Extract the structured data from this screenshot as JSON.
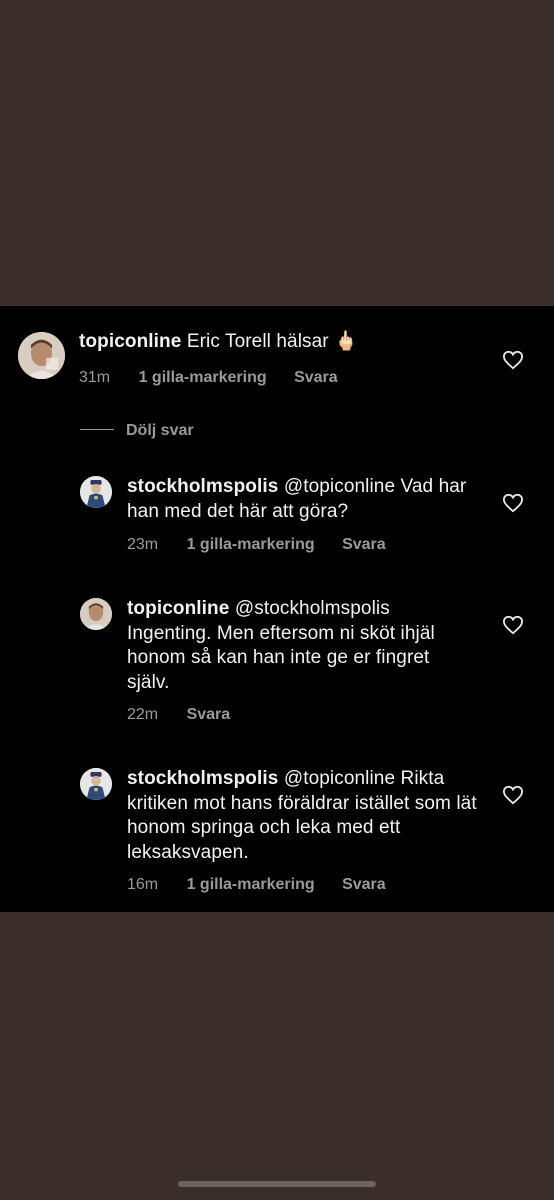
{
  "comments": [
    {
      "username": "topiconline",
      "text": "Eric Torell hälsar 🖕🏻",
      "time": "31m",
      "likes": "1 gilla-markering",
      "reply": "Svara"
    }
  ],
  "hide_replies": "Dölj svar",
  "replies": [
    {
      "username": "stockholmspolis",
      "text": "@topiconline Vad har han med det här att göra?",
      "time": "23m",
      "likes": "1 gilla-markering",
      "reply": "Svara"
    },
    {
      "username": "topiconline",
      "text": "@stockholmspolis Ingenting. Men eftersom ni sköt ihjäl honom så kan han inte ge er fingret själv.",
      "time": "22m",
      "reply": "Svara"
    },
    {
      "username": "stockholmspolis",
      "text": "@topiconline Rikta kritiken mot hans föräldrar istället som lät honom springa och leka med ett leksaksvapen.",
      "time": "16m",
      "likes": "1 gilla-markering",
      "reply": "Svara"
    }
  ],
  "icons": {
    "like": "heart-outline-icon"
  },
  "colors": {
    "panel": "#000000",
    "surround": "#3b2d29",
    "meta": "#9a9a9a"
  }
}
